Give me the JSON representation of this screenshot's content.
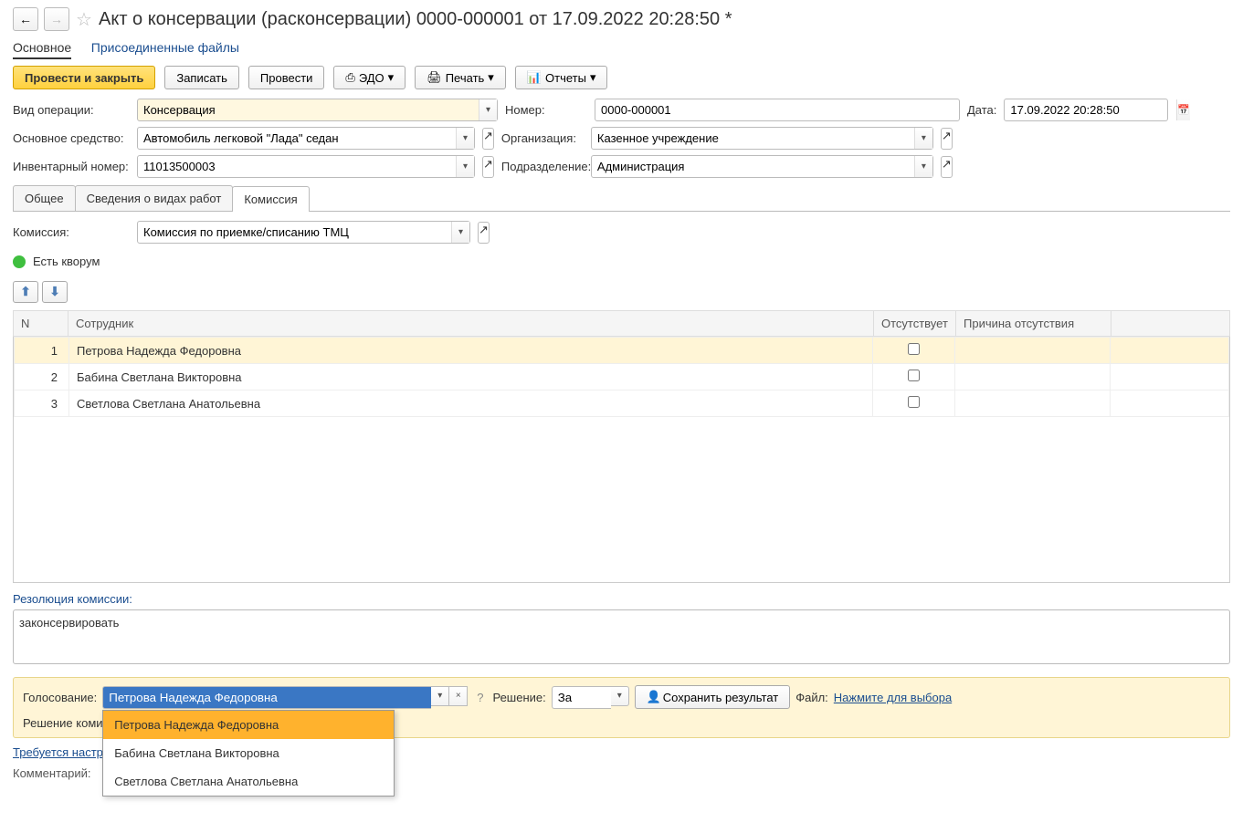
{
  "header": {
    "title": "Акт о консервации (расконсервации) 0000-000001 от 17.09.2022 20:28:50 *"
  },
  "nav": {
    "main": "Основное",
    "files": "Присоединенные файлы"
  },
  "toolbar": {
    "post_close": "Провести и закрыть",
    "save": "Записать",
    "post": "Провести",
    "edo": "ЭДО",
    "print": "Печать",
    "reports": "Отчеты"
  },
  "form": {
    "op_type_label": "Вид операции:",
    "op_type_value": "Консервация",
    "asset_label": "Основное средство:",
    "asset_value": "Автомобиль легковой \"Лада\" седан",
    "inv_label": "Инвентарный номер:",
    "inv_value": "11013500003",
    "number_label": "Номер:",
    "number_value": "0000-000001",
    "org_label": "Организация:",
    "org_value": "Казенное учреждение",
    "dept_label": "Подразделение:",
    "dept_value": "Администрация",
    "date_label": "Дата:",
    "date_value": "17.09.2022 20:28:50"
  },
  "tabs": {
    "general": "Общее",
    "works": "Сведения о видах работ",
    "commission": "Комиссия"
  },
  "commission": {
    "label": "Комиссия:",
    "value": "Комиссия по приемке/списанию ТМЦ",
    "quorum": "Есть кворум"
  },
  "table": {
    "col_n": "N",
    "col_emp": "Сотрудник",
    "col_absent": "Отсутствует",
    "col_reason": "Причина отсутствия",
    "rows": [
      {
        "n": "1",
        "emp": "Петрова Надежда Федоровна"
      },
      {
        "n": "2",
        "emp": "Бабина Светлана Викторовна"
      },
      {
        "n": "3",
        "emp": "Светлова Светлана Анатольевна"
      }
    ]
  },
  "resolution": {
    "label": "Резолюция комиссии:",
    "value": "законсервировать"
  },
  "vote": {
    "voting_label": "Голосование:",
    "voter": "Петрова Надежда Федоровна",
    "decision_label": "Решение:",
    "decision_value": "За",
    "save_result": "Сохранить результат",
    "file_label": "Файл:",
    "file_link": "Нажмите для выбора",
    "commission_decision": "Решение комис"
  },
  "dropdown": {
    "items": [
      "Петрова Надежда Федоровна",
      "Бабина Светлана Викторовна",
      "Светлова Светлана Анатольевна"
    ]
  },
  "footer": {
    "config_needed": "Требуется настрой",
    "comment_label": "Комментарий:"
  }
}
